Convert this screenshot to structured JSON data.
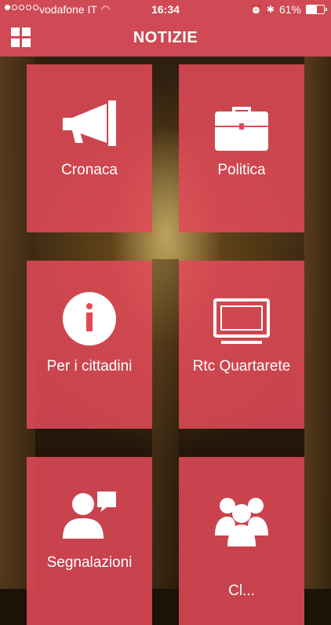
{
  "status_bar": {
    "carrier": "vodafone IT",
    "time": "16:34",
    "battery": "61%",
    "battery_level": 0.61
  },
  "header": {
    "title": "NOTIZIE"
  },
  "tiles": [
    {
      "label": "Cronaca",
      "icon": "megaphone-icon"
    },
    {
      "label": "Politica",
      "icon": "briefcase-icon"
    },
    {
      "label": "Per i cittadini",
      "icon": "info-icon"
    },
    {
      "label": "Rtc Quartarete",
      "icon": "tv-icon"
    },
    {
      "label": "Segnalazioni",
      "icon": "speech-person-icon"
    },
    {
      "label": "Cl...",
      "icon": "group-icon"
    }
  ],
  "colors": {
    "accent": "#cf4a55",
    "tile": "#e04a58"
  }
}
